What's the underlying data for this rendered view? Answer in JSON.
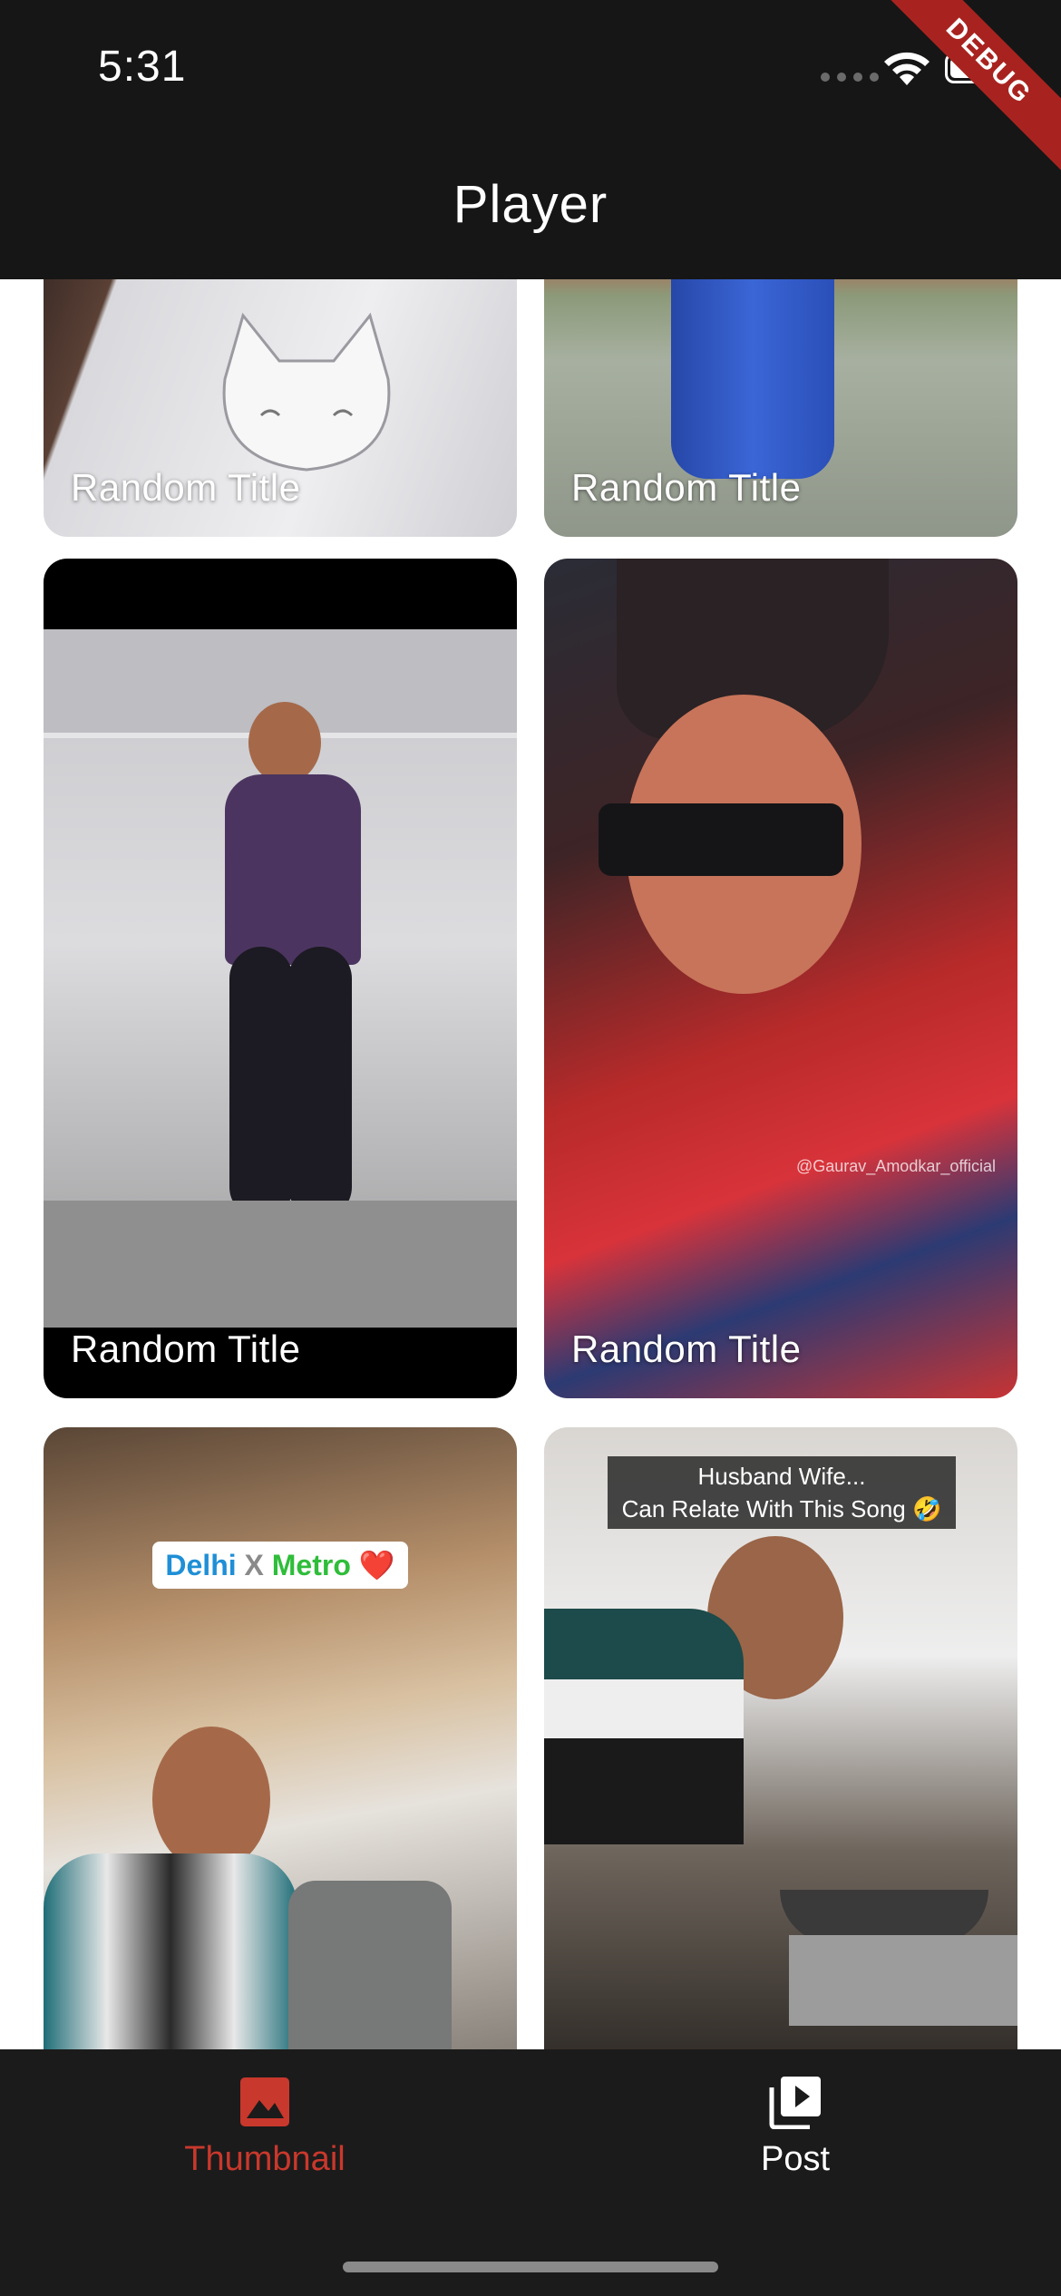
{
  "status_bar": {
    "time": "5:31",
    "debug_label": "DEBUG"
  },
  "app_bar": {
    "title": "Player"
  },
  "grid": {
    "cards": [
      {
        "title": "Random Title"
      },
      {
        "title": "Random Title"
      },
      {
        "title": "Random Title"
      },
      {
        "title": "Random Title",
        "watermark": "@Gaurav_Amodkar_official"
      },
      {
        "overlay": {
          "part1": "Delhi",
          "part2": "X",
          "part3": "Metro",
          "emoji": "❤️"
        }
      },
      {
        "overlay": {
          "line1": "Husband Wife...",
          "line2": "Can Relate With This Song 🤣"
        }
      }
    ]
  },
  "bottom_nav": {
    "items": [
      {
        "label": "Thumbnail",
        "icon": "image-icon",
        "active": true
      },
      {
        "label": "Post",
        "icon": "video-library-icon",
        "active": false
      }
    ],
    "active_color": "#c9382c"
  }
}
